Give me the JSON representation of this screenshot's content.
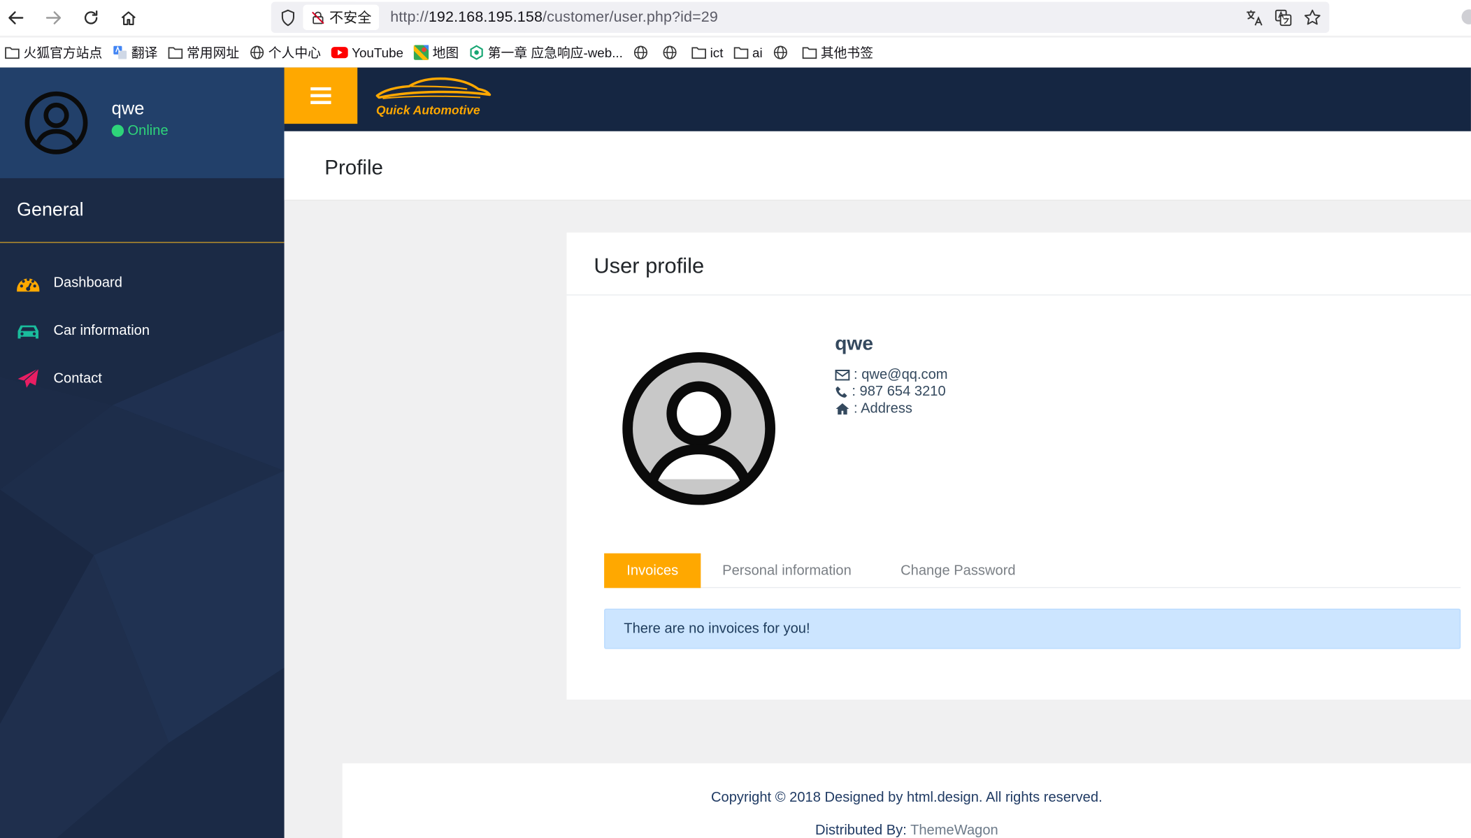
{
  "browser": {
    "security_label": "不安全",
    "url_prefix": "http://",
    "url_host": "192.168.195.158",
    "url_path": "/customer/user.php?id=29",
    "bookmarks": [
      {
        "label": "火狐官方站点",
        "icon": "folder-icon"
      },
      {
        "label": "翻译",
        "icon": "translate-icon"
      },
      {
        "label": "常用网址",
        "icon": "folder-icon"
      },
      {
        "label": "个人中心",
        "icon": "globe-icon"
      },
      {
        "label": "YouTube",
        "icon": "youtube-icon"
      },
      {
        "label": "地图",
        "icon": "map-icon"
      },
      {
        "label": "第一章 应急响应-web...",
        "icon": "hexagon-icon"
      },
      {
        "label": "",
        "icon": "globe-icon"
      },
      {
        "label": "",
        "icon": "globe-icon"
      },
      {
        "label": "ict",
        "icon": "folder-icon"
      },
      {
        "label": "ai",
        "icon": "folder-icon"
      },
      {
        "label": "",
        "icon": "globe-icon"
      },
      {
        "label": "其他书签",
        "icon": "folder-icon"
      }
    ]
  },
  "sidebar": {
    "user_name": "qwe",
    "status": "Online",
    "section_title": "General",
    "items": [
      {
        "label": "Dashboard",
        "icon": "dashboard-icon",
        "color": "#ffa800"
      },
      {
        "label": "Car information",
        "icon": "car-icon",
        "color": "#1abc9c"
      },
      {
        "label": "Contact",
        "icon": "paper-plane-icon",
        "color": "#e91e63"
      }
    ]
  },
  "topbar": {
    "logo_text": "Quick Automotive"
  },
  "page": {
    "title": "Profile"
  },
  "profile_card": {
    "title": "User profile",
    "name": "qwe",
    "email": ": qwe@qq.com",
    "phone": ": 987 654 3210",
    "address": ": Address",
    "tabs": [
      "Invoices",
      "Personal information",
      "Change Password"
    ],
    "active_tab": "Invoices",
    "alert": "There are no invoices for you!"
  },
  "footer": {
    "copyright": "Copyright © 2018 Designed by html.design. All rights reserved.",
    "distributed_label": "Distributed By: ",
    "distributed_by": "ThemeWagon"
  },
  "colors": {
    "accent": "#ffa800",
    "sidebar": "#1b2a45",
    "topbar": "#152642",
    "online": "#2ed47a"
  }
}
